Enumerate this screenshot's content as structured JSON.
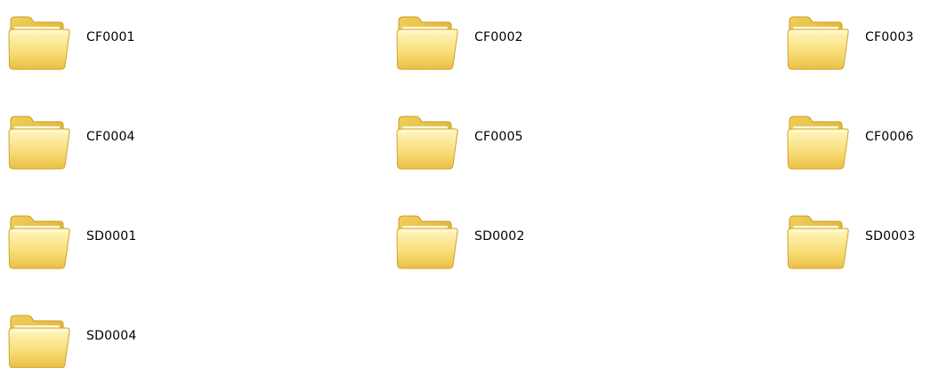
{
  "window": {
    "view": "tiles"
  },
  "colors": {
    "background": "#ffffff",
    "folder_light": "#fff3b8",
    "folder_mid": "#f7d96b",
    "folder_dark": "#d9a928",
    "folder_outline": "#c79a1f"
  },
  "items": [
    {
      "name": "CF0001",
      "icon": "folder-icon"
    },
    {
      "name": "CF0002",
      "icon": "folder-icon"
    },
    {
      "name": "CF0003",
      "icon": "folder-icon"
    },
    {
      "name": "CF0004",
      "icon": "folder-icon"
    },
    {
      "name": "CF0005",
      "icon": "folder-icon"
    },
    {
      "name": "CF0006",
      "icon": "folder-icon"
    },
    {
      "name": "SD0001",
      "icon": "folder-icon"
    },
    {
      "name": "SD0002",
      "icon": "folder-icon"
    },
    {
      "name": "SD0003",
      "icon": "folder-icon"
    },
    {
      "name": "SD0004",
      "icon": "folder-icon"
    }
  ]
}
